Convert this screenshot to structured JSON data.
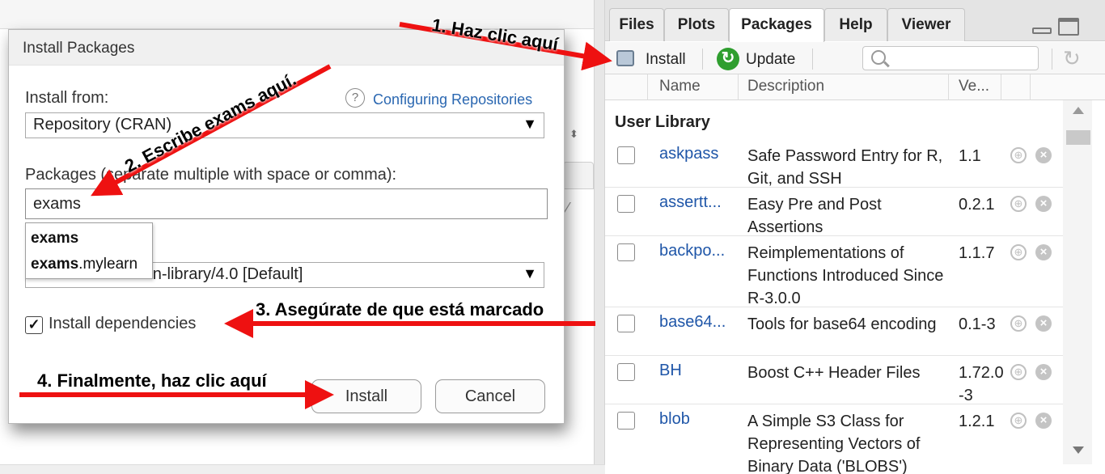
{
  "dialog": {
    "title": "Install Packages",
    "install_from_label": "Install from:",
    "help_link": "Configuring Repositories",
    "install_from_value": "Repository (CRAN)",
    "packages_label": "Packages (separate multiple with space or comma):",
    "packages_value": "exams",
    "autocomplete": [
      {
        "bold": "exams",
        "rest": ""
      },
      {
        "bold": "exams",
        "rest": ".mylearn"
      }
    ],
    "library_value": "OneDrive/Documentos/R/win-library/4.0 [Default]",
    "install_dependencies_label": "Install dependencies",
    "install_dependencies_checked": true,
    "install_button": "Install",
    "cancel_button": "Cancel"
  },
  "pane": {
    "tabs": [
      "Files",
      "Plots",
      "Packages",
      "Help",
      "Viewer"
    ],
    "active_tab": "Packages",
    "toolbar": {
      "install": "Install",
      "update": "Update",
      "search_placeholder": ""
    },
    "columns": [
      "Name",
      "Description",
      "Ve..."
    ],
    "section": "User Library",
    "packages": [
      {
        "name": "askpass",
        "description": "Safe Password Entry for R, Git, and SSH",
        "version": "1.1"
      },
      {
        "name": "assertt...",
        "description": "Easy Pre and Post Assertions",
        "version": "0.2.1"
      },
      {
        "name": "backpo...",
        "description": "Reimplementations of Functions Introduced Since R-3.0.0",
        "version": "1.1.7"
      },
      {
        "name": "base64...",
        "description": "Tools for base64 encoding",
        "version": "0.1-3"
      },
      {
        "name": "BH",
        "description": "Boost C++ Header Files",
        "version": "1.72.0-3"
      },
      {
        "name": "blob",
        "description": "A Simple S3 Class for Representing Vectors of Binary Data ('BLOBS')",
        "version": "1.2.1"
      }
    ]
  },
  "annotations": {
    "step1": "1. Haz clic aquí",
    "step2": "2. Escribe exams aquí.",
    "step3": "3. Asegúrate de que está marcado",
    "step4": "4. Finalmente, haz clic aquí"
  },
  "colors": {
    "link": "#1f56a8",
    "arrow": "#ee1111",
    "update_icon": "#2f9e2f"
  }
}
